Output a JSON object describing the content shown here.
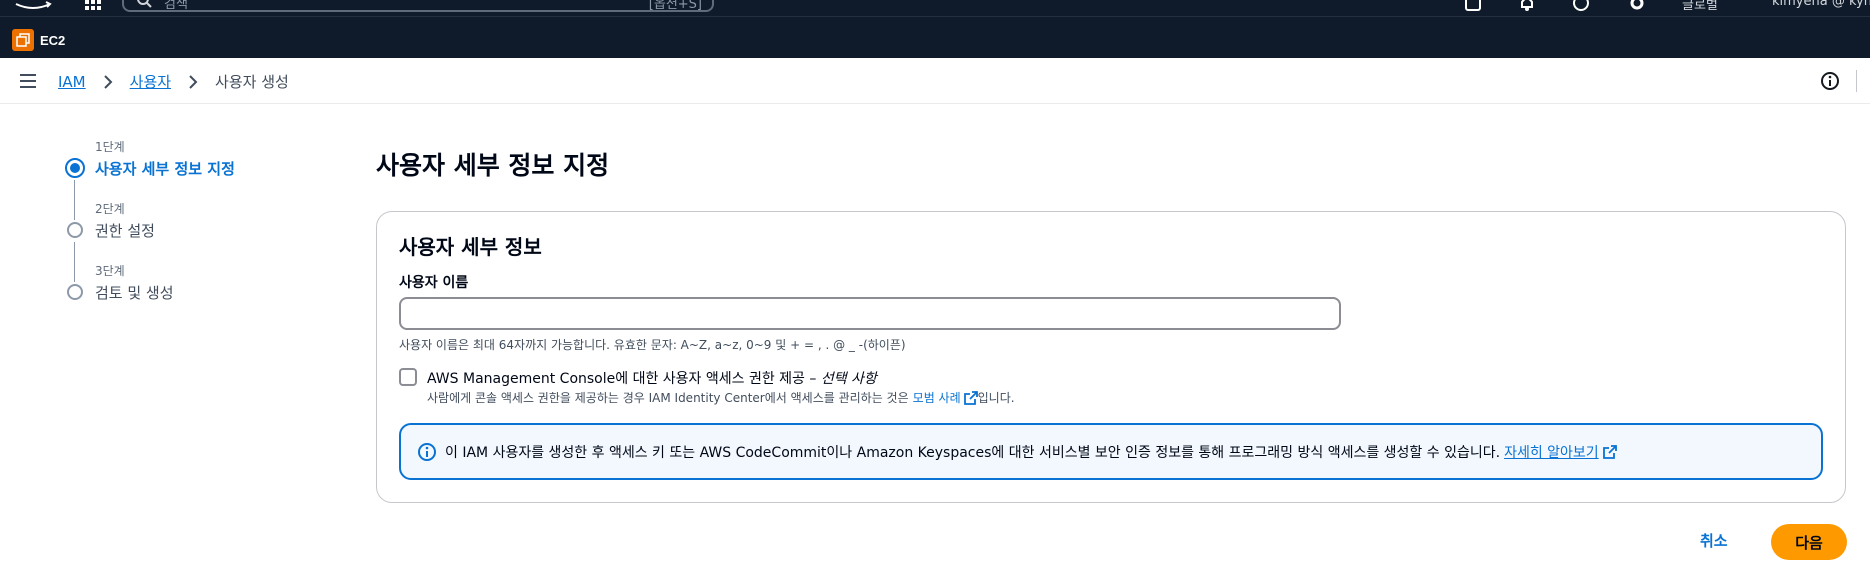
{
  "topnav": {
    "search_placeholder": "검색",
    "search_shortcut": "[옵션+S]",
    "region": "글로벌",
    "user": "kimyena @ kyna"
  },
  "favorites": {
    "service_label": "EC2"
  },
  "breadcrumb": {
    "items": [
      "IAM",
      "사용자"
    ],
    "current": "사용자 생성"
  },
  "wizard": {
    "steps": [
      {
        "number": "1단계",
        "label": "사용자 세부 정보 지정",
        "active": true
      },
      {
        "number": "2단계",
        "label": "권한 설정",
        "active": false
      },
      {
        "number": "3단계",
        "label": "검토 및 생성",
        "active": false
      }
    ]
  },
  "page": {
    "title": "사용자 세부 정보 지정"
  },
  "panel": {
    "title": "사용자 세부 정보",
    "username_label": "사용자 이름",
    "username_value": "",
    "username_hint": "사용자 이름은 최대 64자까지 가능합니다. 유효한 문자: A~Z, a~z, 0~9 및 + = , . @ _ -(하이픈)",
    "console_access_label": "AWS Management Console에 대한 사용자 액세스 권한 제공 – ",
    "console_access_optional": "선택 사항",
    "console_access_desc": "사람에게 콘솔 액세스 권한을 제공하는 경우 IAM Identity Center에서 액세스를 관리하는 것은",
    "console_access_link": "모범 사례",
    "console_access_suffix": "입니다.",
    "alert_text": "이 IAM 사용자를 생성한 후 액세스 키 또는 AWS CodeCommit이나 Amazon Keyspaces에 대한 서비스별 보안 인증 정보를 통해 프로그래밍 방식 액세스를 생성할 수 있습니다.",
    "alert_link": "자세히 알아보기"
  },
  "footer": {
    "cancel_label": "취소",
    "next_label": "다음"
  },
  "colors": {
    "link": "#0972d3",
    "primary_button": "#ff9900",
    "nav_background": "#0f1b2a",
    "service_icon": "#ed7100"
  }
}
